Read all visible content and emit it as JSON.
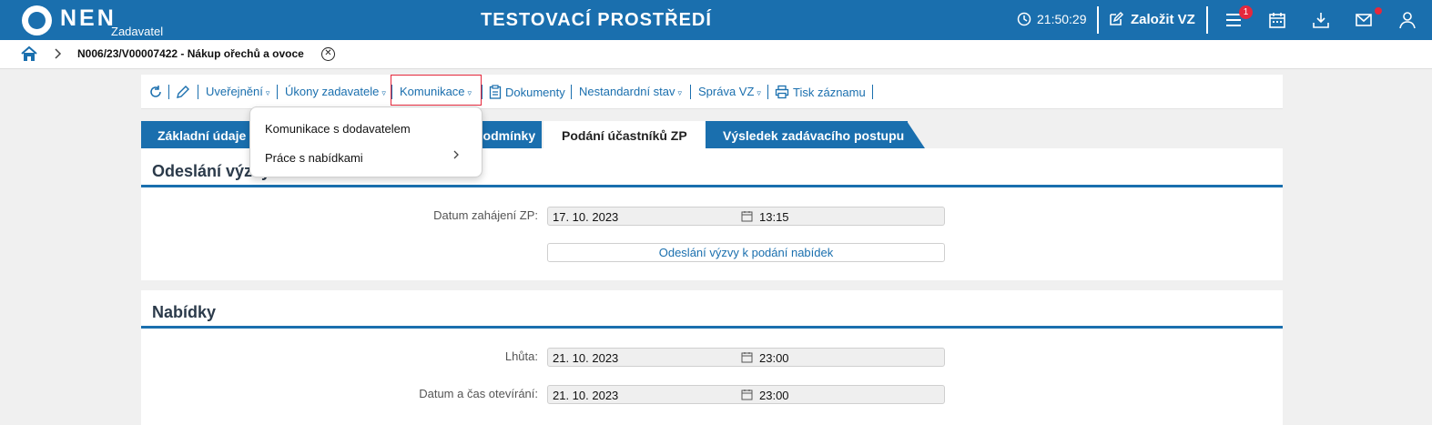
{
  "header": {
    "logo_text": "NEN",
    "logo_sub": "Zadavatel",
    "env_title": "TESTOVACÍ PROSTŘEDÍ",
    "clock": "21:50:29",
    "create_label": "Založit VZ",
    "menu_badge": "1",
    "icons": [
      "clock-icon",
      "edit-icon",
      "menu-icon",
      "calendar-icon",
      "download-icon",
      "mail-icon",
      "user-icon"
    ],
    "accent": "#1a6fae",
    "badge_color": "#e5283c"
  },
  "breadcrumb": {
    "item": "N006/23/V00007422 - Nákup ořechů a ovoce"
  },
  "toolbar": {
    "uverejneni": "Uveřejnění",
    "ukony": "Úkony zadavatele",
    "komunikace": "Komunikace",
    "dokumenty": "Dokumenty",
    "nestandardni": "Nestandardní stav",
    "sprava": "Správa VZ",
    "tisk": "Tisk záznamu",
    "triangle": "▿"
  },
  "tabs": {
    "zakladni": "Základní údaje",
    "podminky": "podmínky",
    "podani": "Podání účastníků ZP",
    "vysledek": "Výsledek zadávacího postupu"
  },
  "dropdown": {
    "item1": "Komunikace s dodavatelem",
    "item2": "Práce s nabídkami"
  },
  "section1": {
    "title": "Odeslání výzvy",
    "datum_label": "Datum zahájení ZP:",
    "datum_date": "17. 10. 2023",
    "datum_time": "13:15",
    "send_button": "Odeslání výzvy k podání nabídek"
  },
  "section2": {
    "title": "Nabídky",
    "lhuta_label": "Lhůta:",
    "lhuta_date": "21. 10. 2023",
    "lhuta_time": "23:00",
    "otevirani_label": "Datum a čas otevírání:",
    "otevirani_date": "21. 10. 2023",
    "otevirani_time": "23:00"
  }
}
